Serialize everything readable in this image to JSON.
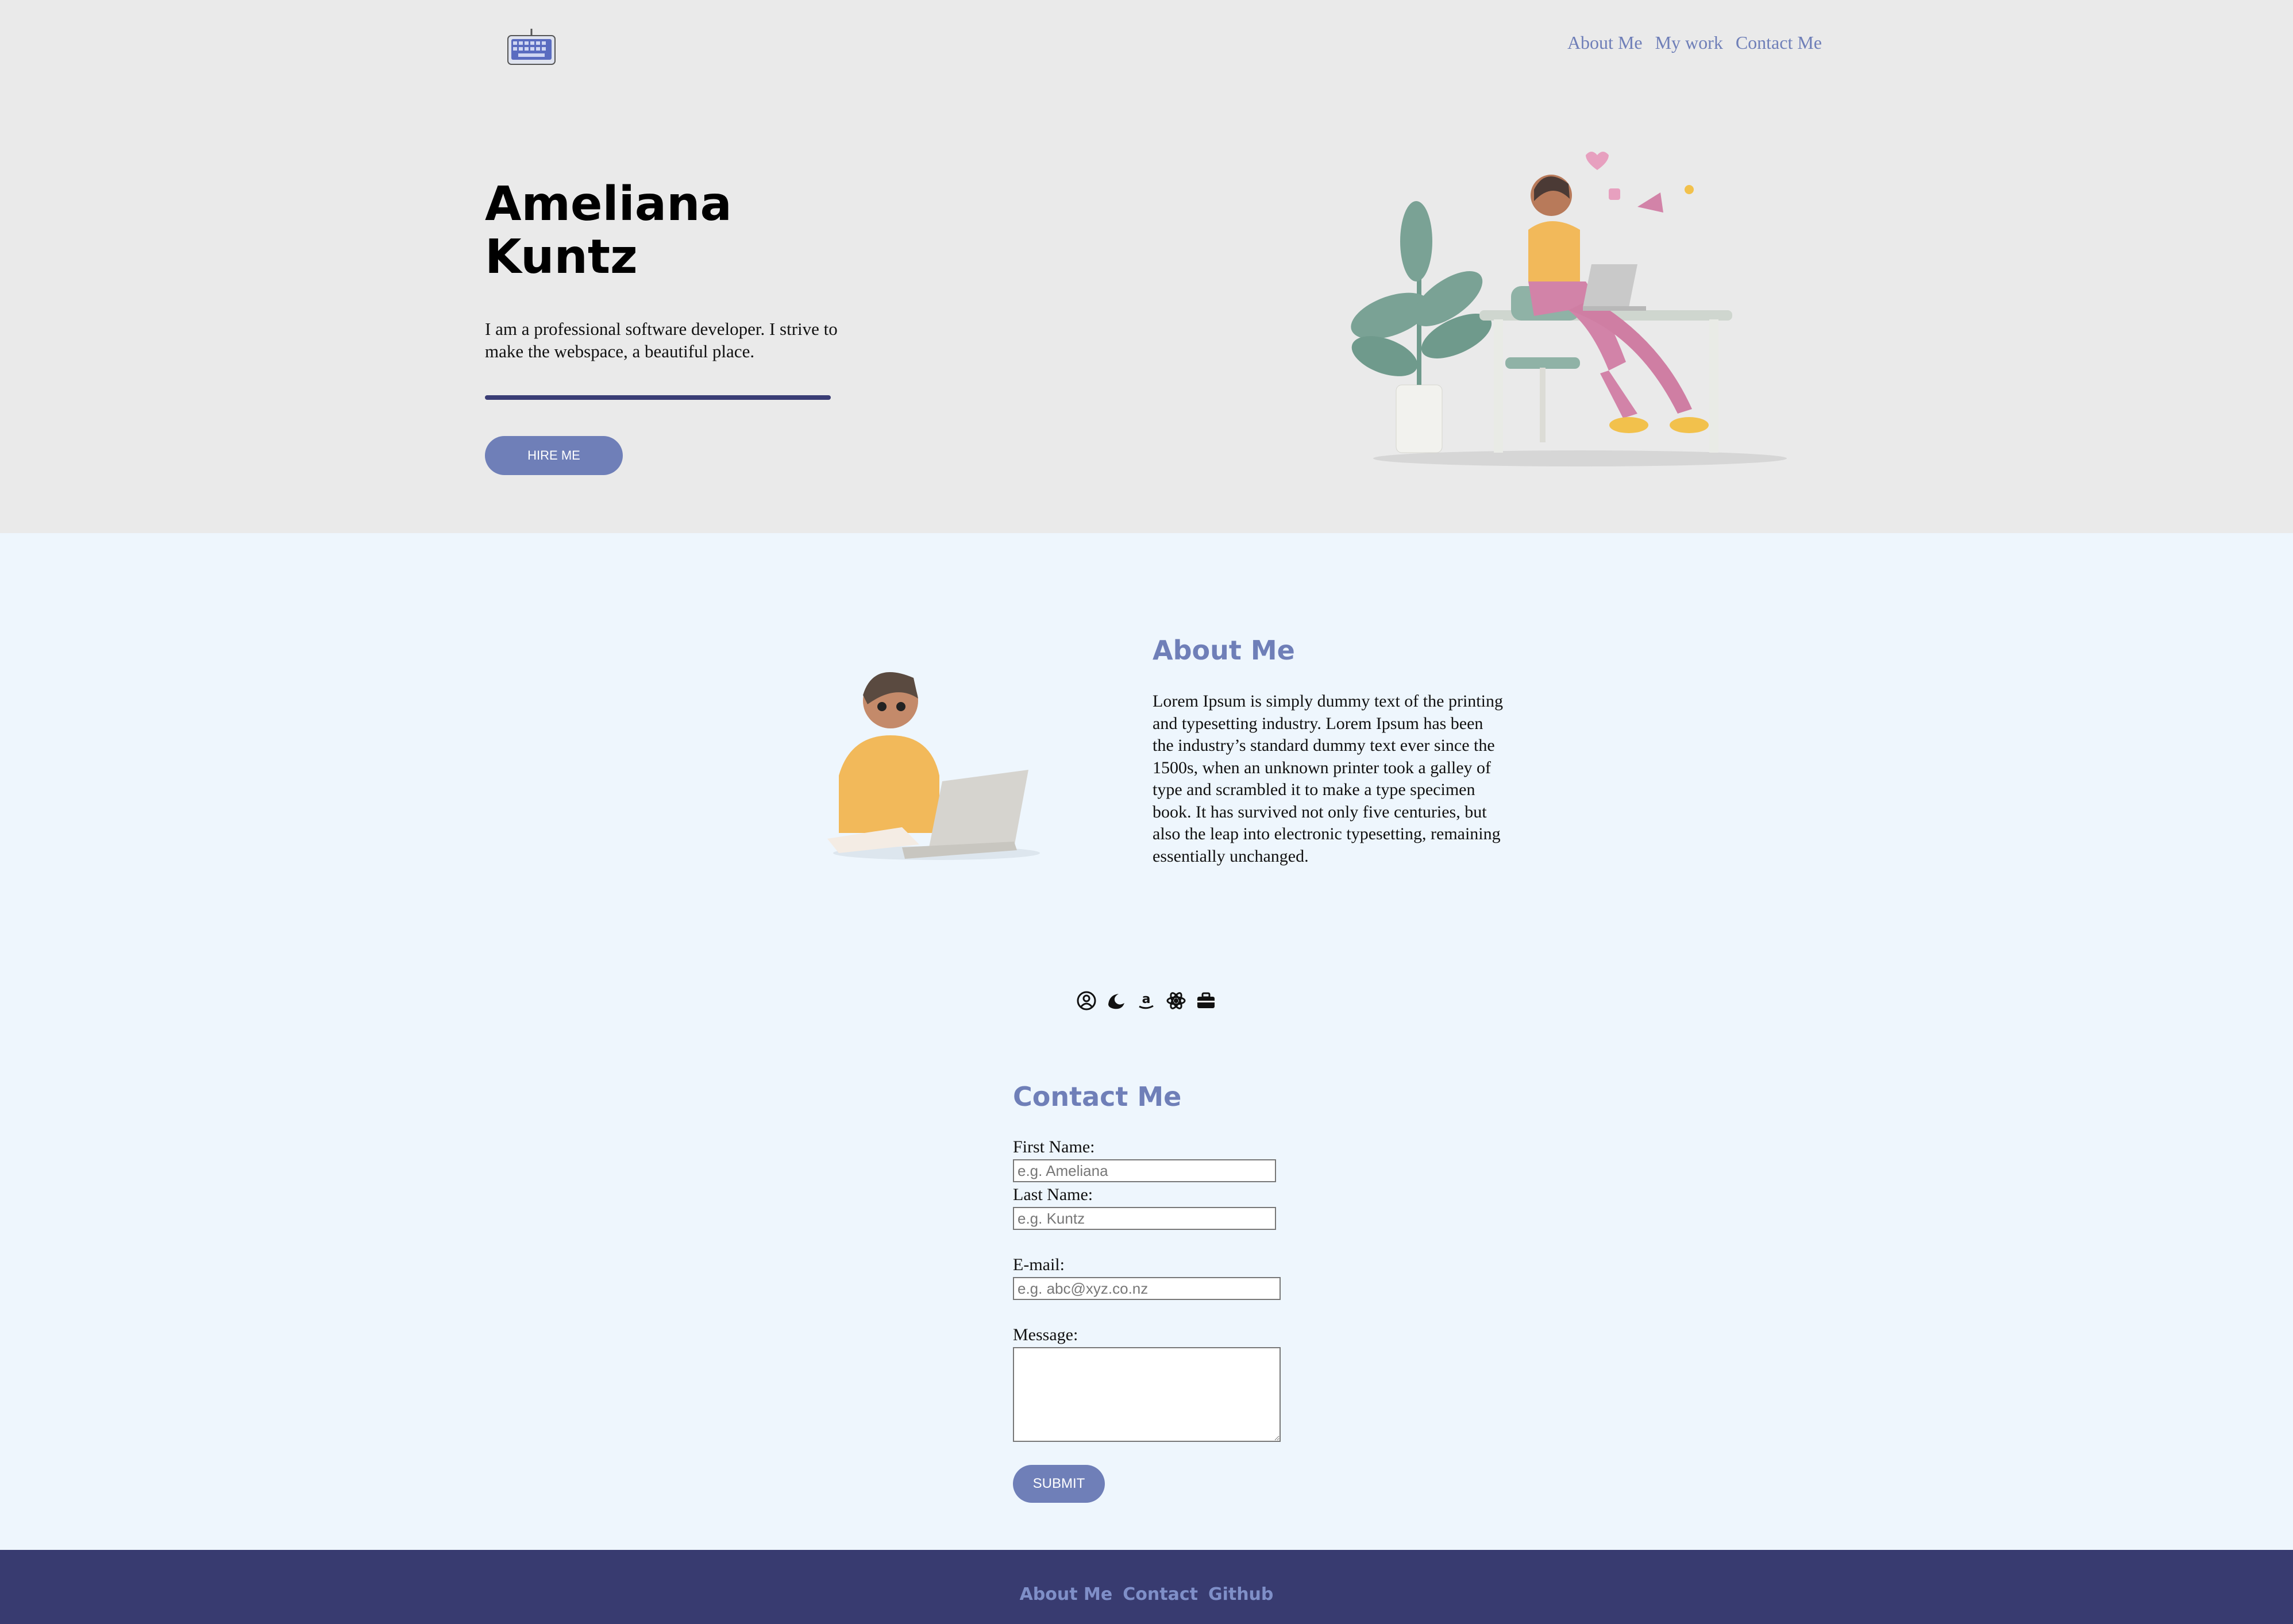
{
  "colors": {
    "accent": "#6f7fb8",
    "hero_bg": "#eaeaea",
    "page_bg": "#eef6fd",
    "footer_bg": "#383b70",
    "rule": "#3a3d75"
  },
  "header": {
    "logo_icon": "keyboard-icon",
    "nav": [
      "About Me",
      "My work",
      "Contact Me"
    ]
  },
  "hero": {
    "name_line1": "Ameliana",
    "name_line2": "Kuntz",
    "description": "I am a professional software developer. I strive to make the webspace, a beautiful place.",
    "hire_button": "HIRE ME",
    "illustration": "woman-at-desk-illustration"
  },
  "about": {
    "title": "About Me",
    "text": "Lorem Ipsum is simply dummy text of the printing and typesetting industry. Lorem Ipsum has been the industry’s standard dummy text ever since the 1500s, when an unknown printer took a galley of type and scrambled it to make a type specimen book. It has survived not only five centuries, but also the leap into electronic typesetting, remaining essentially unchanged.",
    "illustration": "man-with-laptop-illustration"
  },
  "social_icons": [
    "user-circle-icon",
    "swirl-icon",
    "amazon-icon",
    "react-icon",
    "briefcase-icon"
  ],
  "contact": {
    "title": "Contact Me",
    "first_name_label": "First Name:",
    "first_name_placeholder": "e.g. Ameliana",
    "last_name_label": "Last Name:",
    "last_name_placeholder": "e.g. Kuntz",
    "email_label": "E-mail:",
    "email_placeholder": "e.g. abc@xyz.co.nz",
    "message_label": "Message:",
    "submit": "SUBMIT"
  },
  "footer": {
    "links": [
      "About Me",
      "Contact",
      "Github"
    ]
  }
}
